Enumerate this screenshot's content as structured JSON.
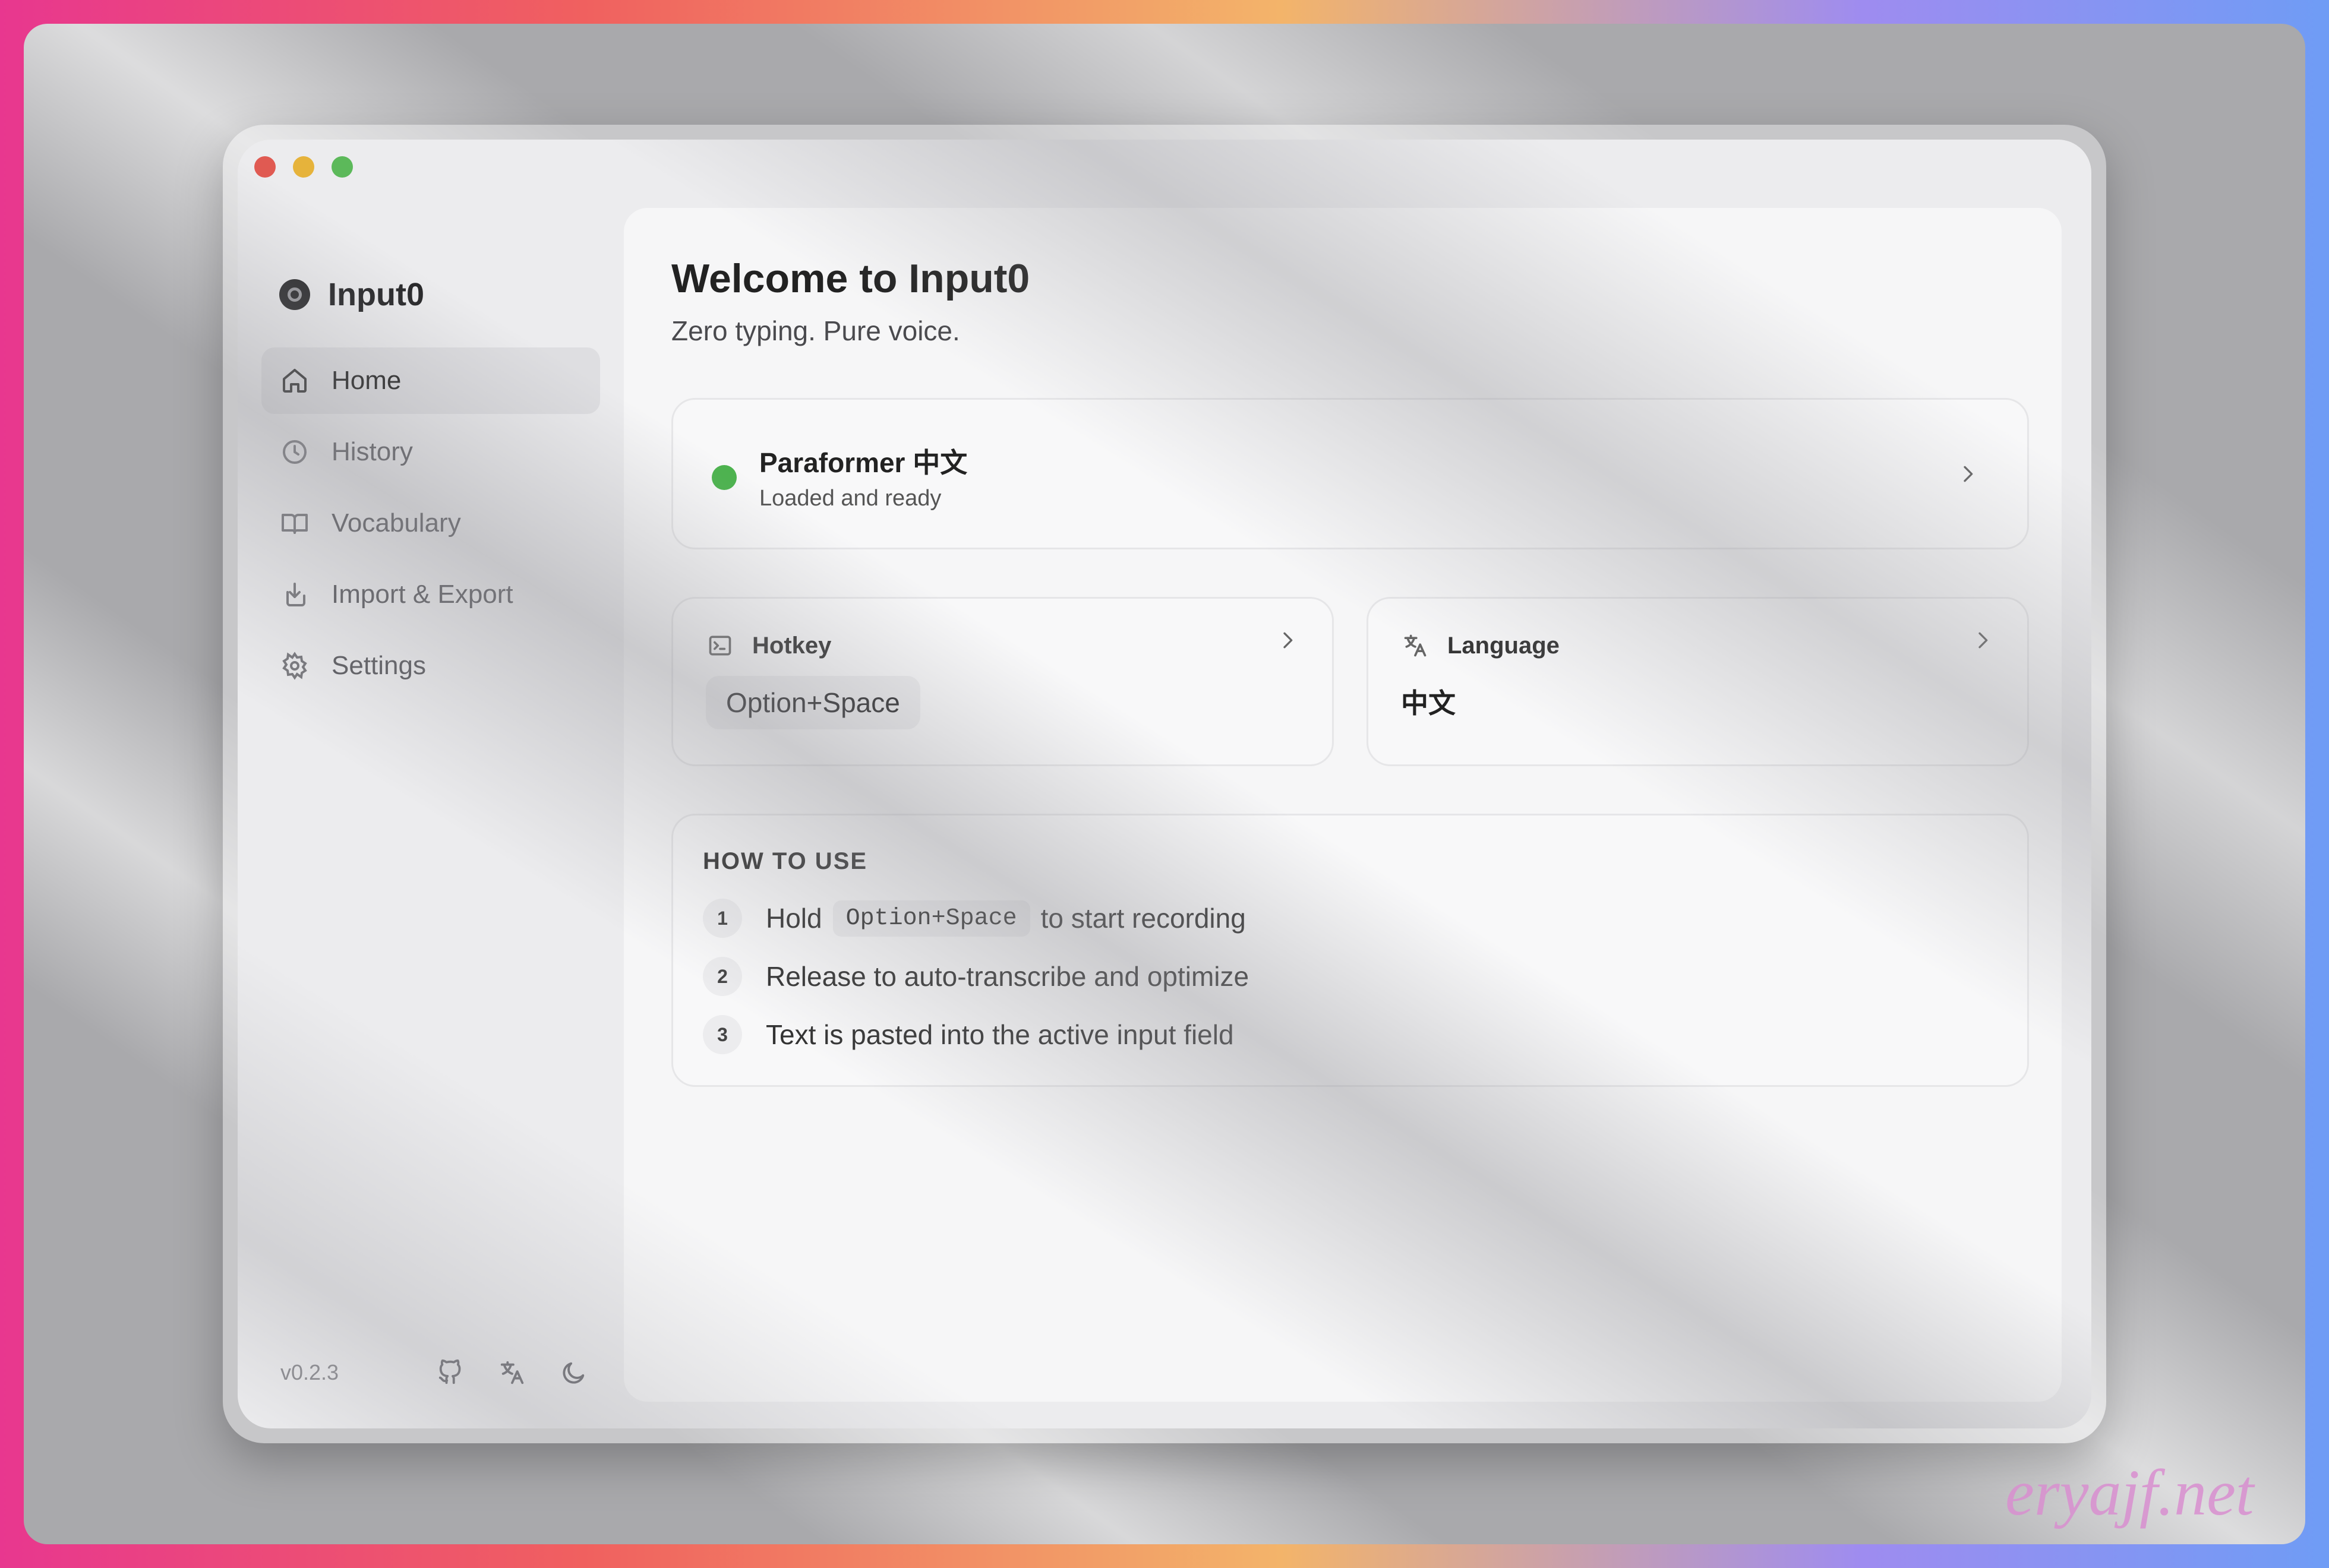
{
  "app": {
    "name": "Input0",
    "version": "v0.2.3"
  },
  "sidebar": {
    "items": [
      {
        "label": "Home",
        "icon": "home-icon",
        "active": true
      },
      {
        "label": "History",
        "icon": "clock-icon",
        "active": false
      },
      {
        "label": "Vocabulary",
        "icon": "book-icon",
        "active": false
      },
      {
        "label": "Import & Export",
        "icon": "import-export-icon",
        "active": false
      },
      {
        "label": "Settings",
        "icon": "gear-icon",
        "active": false
      }
    ],
    "footer_icons": [
      "github-icon",
      "translate-icon",
      "moon-icon"
    ]
  },
  "main": {
    "title": "Welcome to Input0",
    "subtitle": "Zero typing. Pure voice.",
    "model": {
      "name": "Paraformer 中文",
      "status": "Loaded and ready",
      "status_color": "#4cb34e"
    },
    "hotkey": {
      "label": "Hotkey",
      "value": "Option+Space"
    },
    "language": {
      "label": "Language",
      "value": "中文"
    },
    "howto": {
      "title": "HOW TO USE",
      "steps": [
        {
          "num": "1",
          "before": "Hold",
          "code": "Option+Space",
          "after": "to start recording"
        },
        {
          "num": "2",
          "text": "Release to auto-transcribe and optimize"
        },
        {
          "num": "3",
          "text": "Text is pasted into the active input field"
        }
      ]
    }
  },
  "watermark": "eryajf.net",
  "colors": {
    "traffic_close": "#e05a52",
    "traffic_min": "#e6b33b",
    "traffic_max": "#5cb95a"
  }
}
